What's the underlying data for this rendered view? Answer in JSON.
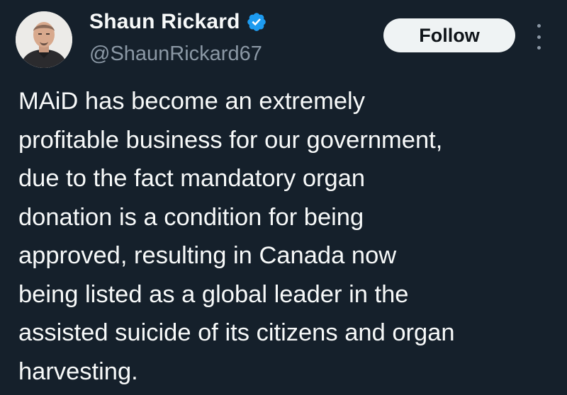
{
  "author": {
    "display_name": "Shaun Rickard",
    "handle": "@ShaunRickard67",
    "verified": true,
    "verified_icon": "verified-badge-icon",
    "avatar_icon": "profile-photo"
  },
  "actions": {
    "follow_label": "Follow",
    "more_icon": "more-options-icon"
  },
  "tweet": {
    "text": "MAiD has become an extremely\nprofitable business for our government,\ndue to the fact mandatory organ\ndonation is a condition for being\napproved, resulting in Canada now\nbeing listed as a global leader in the\nassisted suicide of its citizens and organ\nharvesting."
  },
  "colors": {
    "background": "#15202b",
    "text": "#f7f9f9",
    "muted": "#8b98a5",
    "verified": "#1d9bf0",
    "follow_bg": "#eff3f4"
  }
}
